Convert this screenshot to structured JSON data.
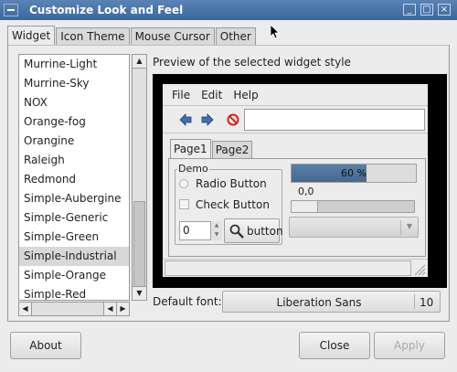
{
  "window": {
    "title": "Customize Look and Feel"
  },
  "tabs": [
    {
      "label": "Widget",
      "active": true
    },
    {
      "label": "Icon Theme",
      "active": false
    },
    {
      "label": "Mouse Cursor",
      "active": false
    },
    {
      "label": "Other",
      "active": false
    }
  ],
  "theme_list": {
    "items": [
      "Murrine-Light",
      "Murrine-Sky",
      "NOX",
      "Orange-fog",
      "Orangine",
      "Raleigh",
      "Redmond",
      "Simple-Aubergine",
      "Simple-Generic",
      "Simple-Green",
      "Simple-Industrial",
      "Simple-Orange",
      "Simple-Red"
    ],
    "selected": "Simple-Industrial"
  },
  "preview": {
    "label": "Preview of the selected widget style",
    "menu": [
      "File",
      "Edit",
      "Help"
    ],
    "toolbar_icons": [
      "back-arrow-icon",
      "forward-arrow-icon",
      "stop-icon"
    ],
    "tabs": [
      {
        "label": "Page1",
        "active": true
      },
      {
        "label": "Page2",
        "active": false
      }
    ],
    "demo": {
      "legend": "Demo",
      "radio_label": "Radio Button",
      "check_label": "Check Button",
      "spin_value": "0",
      "button_label": "button"
    },
    "progress": {
      "text": "60 %",
      "value": 0.6
    },
    "scale_value": "0,0",
    "colors": {
      "progress_fill": "#4f7399",
      "frame": "#000000"
    }
  },
  "font": {
    "label": "Default font:",
    "name": "Liberation Sans",
    "size": "10"
  },
  "buttons": {
    "about": "About",
    "close": "Close",
    "apply": "Apply"
  }
}
